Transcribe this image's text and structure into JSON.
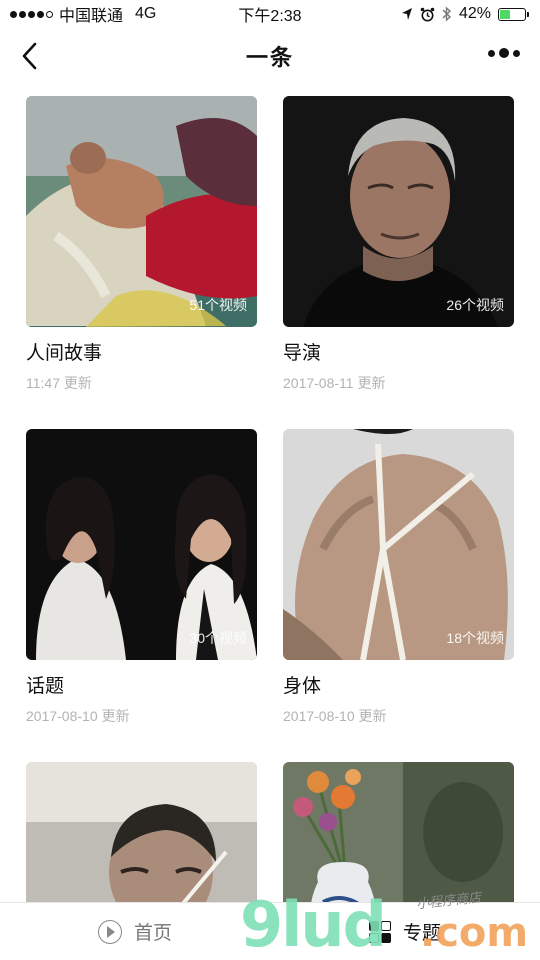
{
  "status_bar": {
    "carrier": "中国联通",
    "network": "4G",
    "time": "下午2:38",
    "battery": "42%",
    "battery_level": 0.42
  },
  "nav": {
    "title": "一条"
  },
  "cards": [
    {
      "title": "人间故事",
      "count": "51个视频",
      "date": "11:47 更新"
    },
    {
      "title": "导演",
      "count": "26个视频",
      "date": "2017-08-11 更新"
    },
    {
      "title": "话题",
      "count": "30个视频",
      "date": "2017-08-10 更新"
    },
    {
      "title": "身体",
      "count": "18个视频",
      "date": "2017-08-10 更新"
    },
    {
      "title": "",
      "count": "",
      "date": ""
    },
    {
      "title": "",
      "count": "",
      "date": ""
    }
  ],
  "tabs": {
    "home": "首页",
    "topics": "专题"
  },
  "watermark": {
    "text": "9lud",
    "suffix": ".com",
    "handwritten": "小程序商店"
  }
}
